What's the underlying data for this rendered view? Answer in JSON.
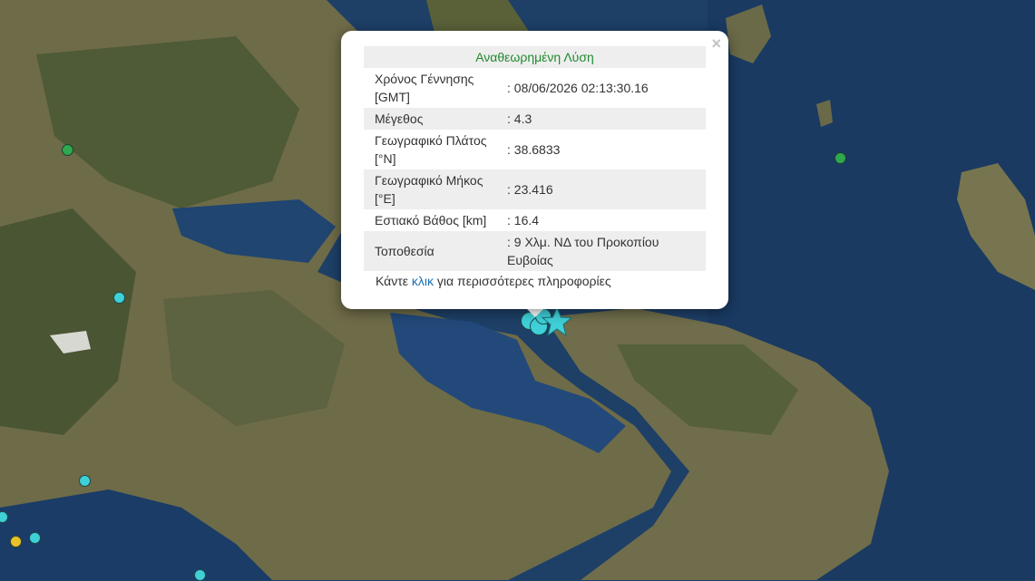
{
  "popup": {
    "title": "Αναθεωρημένη Λύση",
    "rows": [
      {
        "label": "Χρόνος Γέννησης [GMT]",
        "value": ": 08/06/2026 02:13:30.16"
      },
      {
        "label": "Μέγεθος",
        "value": ": 4.3"
      },
      {
        "label": "Γεωγραφικό Πλάτος [°N]",
        "value": ": 38.6833"
      },
      {
        "label": "Γεωγραφικό Μήκος [°E]",
        "value": ": 23.416"
      },
      {
        "label": "Εστιακό Βάθος [km]",
        "value": ": 16.4"
      },
      {
        "label": "Τοποθεσία",
        "value": ": 9 Χλμ. ΝΔ του Προκοπίου Ευβοίας"
      }
    ],
    "more_prefix": "Κάντε ",
    "more_link": "κλικ",
    "more_suffix": " για περισσότερες πληροφορίες",
    "close_symbol": "×"
  },
  "colors": {
    "title_green": "#1f8a2e",
    "link_blue": "#1a6fb3",
    "marker_cyan": "#3fd0d8",
    "marker_green": "#2fa84f",
    "marker_yellow": "#e8c228",
    "sea": "#1e3f66",
    "land": "#6b6a4a"
  },
  "icons": {
    "event_marker": "star-icon",
    "close": "close-icon"
  }
}
